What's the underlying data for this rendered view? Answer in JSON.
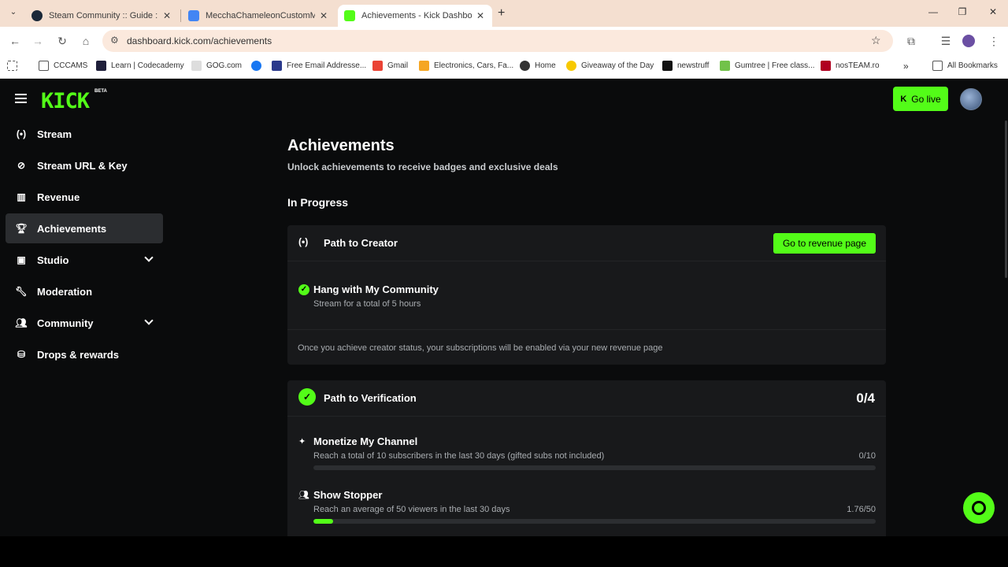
{
  "browser": {
    "tabs": [
      {
        "title": "Steam Community :: Guide :: Ho",
        "active": false
      },
      {
        "title": "MecchaChameleonCustomMod",
        "active": false
      },
      {
        "title": "Achievements - Kick Dashboard",
        "active": true
      }
    ],
    "new_tab": "+",
    "url": "dashboard.kick.com/achievements",
    "bookmarks": [
      "CCCAMS",
      "Learn | Codecademy",
      "GOG.com",
      "Free Email Addresse...",
      "Gmail",
      "Electronics, Cars, Fa...",
      "Home",
      "Giveaway of the Day",
      "newstruff",
      "Gumtree | Free class...",
      "nosTEAM.ro"
    ],
    "bookmarks_overflow": "»",
    "all_bookmarks": "All Bookmarks"
  },
  "app": {
    "logo": "KICK",
    "logo_badge": "BETA",
    "go_live": "Go live",
    "sidebar": [
      {
        "label": "Stream",
        "icon": "broadcast-icon"
      },
      {
        "label": "Stream URL & Key",
        "icon": "link-icon"
      },
      {
        "label": "Revenue",
        "icon": "chart-icon"
      },
      {
        "label": "Achievements",
        "icon": "trophy-icon"
      },
      {
        "label": "Studio",
        "icon": "studio-icon"
      },
      {
        "label": "Moderation",
        "icon": "wrench-icon"
      },
      {
        "label": "Community",
        "icon": "users-icon"
      },
      {
        "label": "Drops & rewards",
        "icon": "gift-icon"
      }
    ]
  },
  "page": {
    "title": "Achievements",
    "subtitle": "Unlock achievements to receive badges and exclusive deals",
    "section": "In Progress",
    "creator": {
      "title": "Path to Creator",
      "button": "Go to revenue page",
      "item_title": "Hang with My Community",
      "item_desc": "Stream for a total of 5 hours",
      "note": "Once you achieve creator status, your subscriptions will be enabled via your new revenue page"
    },
    "verification": {
      "title": "Path to Verification",
      "count": "0/4",
      "items": [
        {
          "title": "Monetize My Channel",
          "desc": "Reach a total of 10 subscribers in the last 30 days (gifted subs not included)",
          "progress": "0/10",
          "fraction": 0
        },
        {
          "title": "Show Stopper",
          "desc": "Reach an average of 50 viewers in the last 30 days",
          "progress": "1.76/50",
          "fraction": 0.0352
        }
      ]
    }
  },
  "colors": {
    "accent": "#53fc18",
    "background": "#0a0b0c",
    "card": "#18191b"
  }
}
